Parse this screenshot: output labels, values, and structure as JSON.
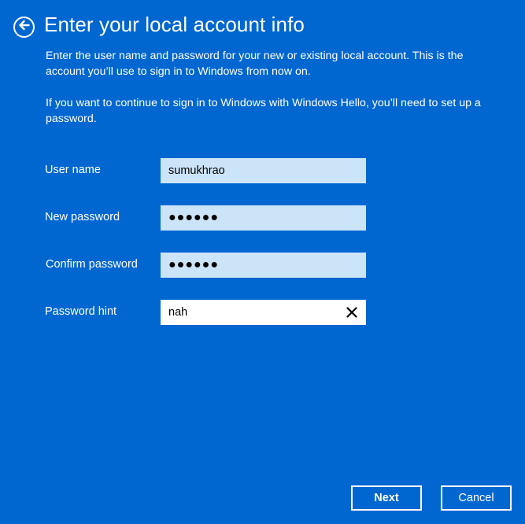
{
  "header": {
    "back_icon": "back-arrow-circle-icon",
    "title": "Enter your local account info"
  },
  "description": {
    "paragraph1": "Enter the user name and password for your new or existing local account. This is the account you’ll use to sign in to Windows from now on.",
    "paragraph2": "If you want to continue to sign in to Windows with Windows Hello, you’ll need to set up a password."
  },
  "form": {
    "username": {
      "label": "User name",
      "value": "sumukhrao"
    },
    "new_password": {
      "label": "New password",
      "value": "●●●●●●"
    },
    "confirm_password": {
      "label": "Confirm password",
      "value": "●●●●●●"
    },
    "password_hint": {
      "label": "Password hint",
      "value": "nah",
      "clear_icon": "close-x-icon"
    }
  },
  "buttons": {
    "next": "Next",
    "cancel": "Cancel"
  },
  "colors": {
    "background": "#0067d1",
    "field_background": "#cce4f7",
    "active_field_background": "#ffffff"
  }
}
